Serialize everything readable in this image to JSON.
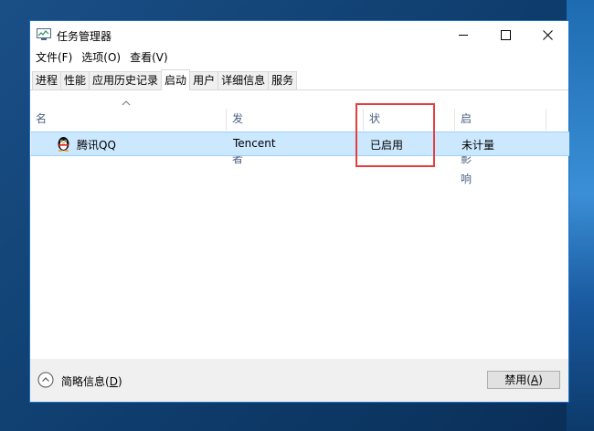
{
  "window": {
    "title": "任务管理器"
  },
  "menu": [
    {
      "label": "文件(F)"
    },
    {
      "label": "选项(O)"
    },
    {
      "label": "查看(V)"
    }
  ],
  "tabs": [
    {
      "label": "进程"
    },
    {
      "label": "性能"
    },
    {
      "label": "应用历史记录"
    },
    {
      "label": "启动",
      "active": true
    },
    {
      "label": "用户"
    },
    {
      "label": "详细信息"
    },
    {
      "label": "服务"
    }
  ],
  "columns": {
    "name": "名称",
    "publisher": "发布者",
    "status": "状态",
    "impact": "启动影响"
  },
  "rows": [
    {
      "name": "腾讯QQ",
      "publisher": "Tencent",
      "status": "已启用",
      "impact": "未计量"
    }
  ],
  "footer": {
    "less_label": "简略信息(",
    "less_key": "D",
    "less_suffix": ")",
    "disable_label": "禁用(",
    "disable_key": "A",
    "disable_suffix": ")"
  },
  "colors": {
    "selection": "#cce8ff",
    "highlight": "#e53e3e",
    "window_border": "#1c6fc4"
  },
  "icons": {
    "app": "task-manager-icon",
    "row": "qq-penguin-icon",
    "footer": "chevron-up-circle-icon"
  }
}
